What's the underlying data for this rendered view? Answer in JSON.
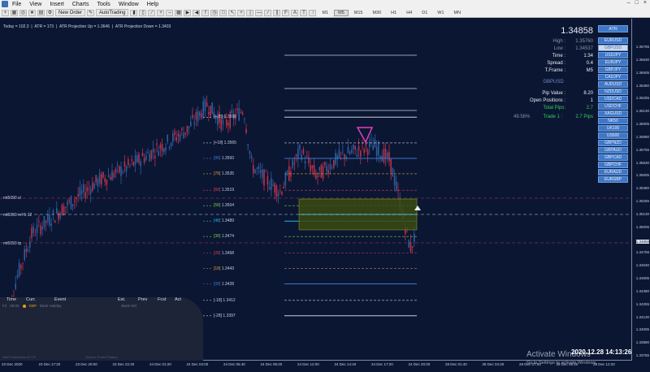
{
  "menu": [
    "File",
    "View",
    "Insert",
    "Charts",
    "Tools",
    "Window",
    "Help"
  ],
  "toolbar": {
    "new_order": "New Order",
    "autotrading": "AutoTrading",
    "timeframes": [
      "M1",
      "M5",
      "M15",
      "M30",
      "H1",
      "H4",
      "D1",
      "W1",
      "MN"
    ]
  },
  "header": {
    "today": "Today = 102.3",
    "atr": "ATR = 173",
    "proj_up": "ATR Projection Up = 1.3646",
    "proj_down": "ATR Projection Down = 1.3403"
  },
  "levels": [
    {
      "label": "[+28]",
      "price": "1.3590"
    },
    {
      "label": "[+18]",
      "price": "1.3565"
    },
    {
      "label": "[88]",
      "price": "1.3550"
    },
    {
      "label": "[78]",
      "price": "1.3535"
    },
    {
      "label": "[68]",
      "price": "1.3519"
    },
    {
      "label": "[58]",
      "price": "1.3504"
    },
    {
      "label": "[48]",
      "price": "1.3489"
    },
    {
      "label": "[38]",
      "price": "1.3474"
    },
    {
      "label": "[28]",
      "price": "1.3458"
    },
    {
      "label": "[18]",
      "price": "1.3443"
    },
    {
      "label": "[08]",
      "price": "1.3428"
    },
    {
      "label": "[-18]",
      "price": "1.3412"
    },
    {
      "label": "[-28]",
      "price": "1.3397"
    }
  ],
  "left_marks": [
    "mt5090 sl",
    "mt5093 ref 5-12",
    "mt5093 tp"
  ],
  "panel": {
    "atr_button": "ATR",
    "price": "1.34858",
    "high_label": "High :",
    "high": "1.35760",
    "low_label": "Low :",
    "low": "1.34537",
    "time_label": "Time :",
    "time": "1:34",
    "spread_label": "Spread :",
    "spread": "0.4",
    "tframe_label": "T.Frame :",
    "tframe": "M5",
    "symbol": "GBPUSD",
    "pip_value_label": "Pip Value :",
    "pip_value": "8.20",
    "open_pos_label": "Open Positions :",
    "open_pos": "1",
    "total_pips_label": "Total Pips:",
    "total_pips": "2.7",
    "pct": "49.56%",
    "trade_label": "Trade 1 :",
    "trade_pips": "2.7 Pips"
  },
  "symbols": [
    "EURUSD",
    "GBPUSD",
    "USDJPY",
    "EURJPY",
    "GBPJPY",
    "CADJPY",
    "AUDUSD",
    "NZDUSD",
    "USDCAD",
    "USDCHF",
    "XAGUSD",
    "NK50",
    "UK100",
    "US500",
    "GBPNZD",
    "GBPAUD",
    "GBPCAD",
    "GBPCHF",
    "EURAUD",
    "EURGBP"
  ],
  "y_axis": [
    "1.36755",
    "1.36630",
    "1.36505",
    "1.36380",
    "1.36255",
    "1.36130",
    "1.36005",
    "1.35880",
    "1.35755",
    "1.35630",
    "1.35505",
    "1.35380",
    "1.35255",
    "1.35130",
    "1.35005",
    "1.34858",
    "1.34755",
    "1.34630",
    "1.34505",
    "1.34380",
    "1.34255",
    "1.34130",
    "1.34005",
    "1.33880",
    "1.33755"
  ],
  "x_axis": [
    "23 Dec 2020",
    "23 Dec 17:20",
    "23 Dec 20:00",
    "23 Dec 22:40",
    "24 Dec 01:20",
    "24 Dec 04:00",
    "24 Dec 06:40",
    "24 Dec 09:20",
    "24 Dec 12:00",
    "24 Dec 14:40",
    "24 Dec 17:20",
    "24 Dec 20:00",
    "28 Dec 01:40",
    "28 Dec 04:20",
    "28 Dec 07:00",
    "28 Dec 09:40",
    "28 Dec 12:20"
  ],
  "news": {
    "headers": [
      "Time",
      "Curr.",
      "Event",
      "Est.",
      "Prev",
      "Fcst",
      "Act"
    ],
    "row": {
      "day": "Fri",
      "time": "09:00",
      "curr": "GBP",
      "event": "Bank Holiday",
      "est": "Bank Hld"
    },
    "footer_left": "SwFX-NewsInfo v1.7.5",
    "footer_mid": "Source: Forex Factory"
  },
  "clock": "2020.12.28 14:13:26",
  "watermark": {
    "title": "Activate Windows",
    "sub": "Go to Settings to activate Windows."
  },
  "colors": {
    "bg": "#0b1633",
    "bull": "#2c5e9c",
    "bear": "#b8324a",
    "accent": "#3e77c7"
  }
}
